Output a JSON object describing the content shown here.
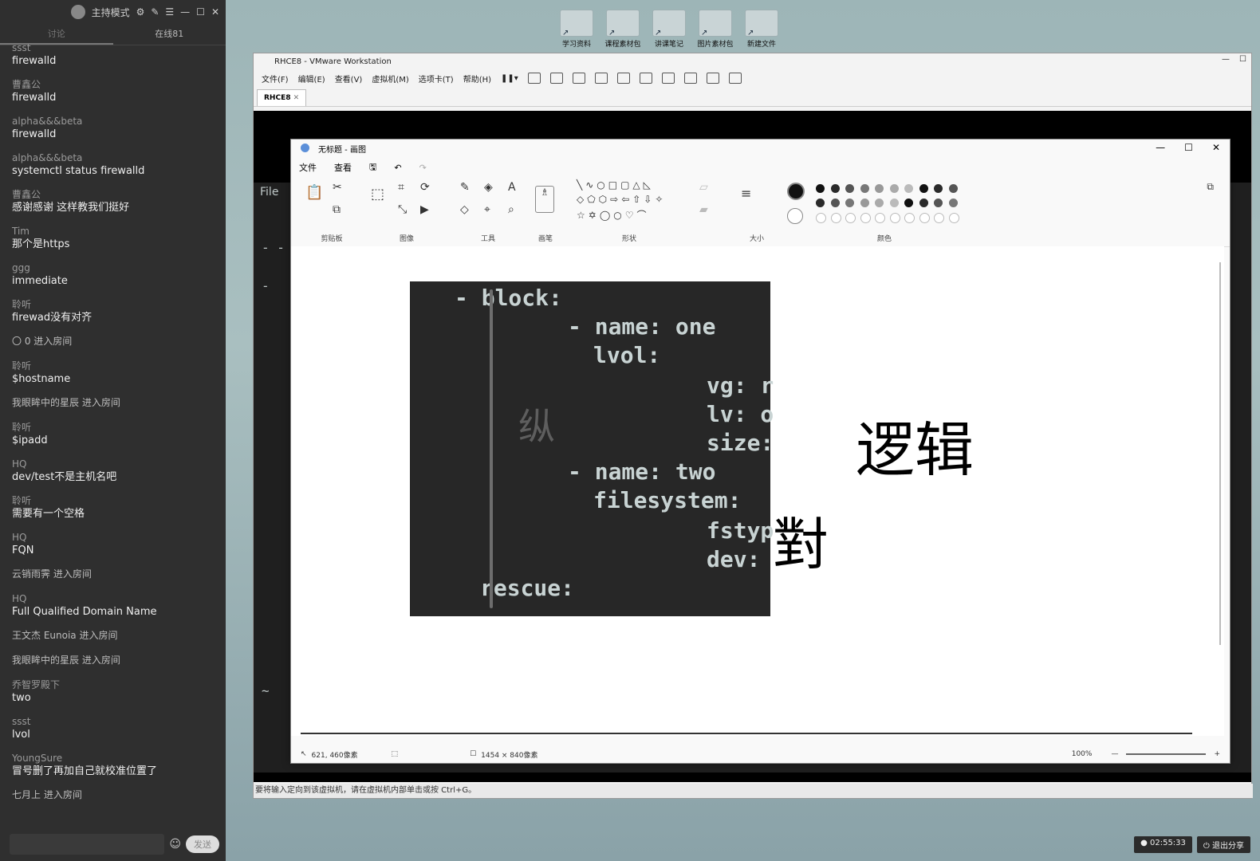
{
  "chat": {
    "title_label": "主持模式",
    "tabs": [
      "讨论",
      "在线81"
    ],
    "messages": [
      {
        "who": "ssst",
        "text": "firewalld"
      },
      {
        "who": "曹鑫公",
        "text": "firewalld"
      },
      {
        "who": "alpha&&&beta",
        "text": "firewalld"
      },
      {
        "who": "alpha&&&beta",
        "text": "systemctl status firewalld"
      },
      {
        "who": "曹鑫公",
        "text": "感谢感谢  这样教我们挺好"
      },
      {
        "who": "Tim",
        "text": "那个是https"
      },
      {
        "who": "ggg",
        "text": "immediate"
      },
      {
        "who": "聆听",
        "text": "firewad没有对齐"
      },
      {
        "system": "〇 0 进入房间"
      },
      {
        "who": "聆听",
        "text": "$hostname"
      },
      {
        "system": "我眼眸中的星辰 进入房间"
      },
      {
        "who": "聆听",
        "text": "$ipadd"
      },
      {
        "who": "HQ",
        "text": "dev/test不是主机名吧"
      },
      {
        "who": "聆听",
        "text": "需要有一个空格"
      },
      {
        "who": "HQ",
        "text": "FQN"
      },
      {
        "system": "云销雨霁 进入房间"
      },
      {
        "who": "HQ",
        "text": "Full Qualified Domain Name"
      },
      {
        "system": "王文杰 Eunoia 进入房间"
      },
      {
        "system": "我眼眸中的星辰 进入房间"
      },
      {
        "who": "乔智罗殿下",
        "text": "two"
      },
      {
        "who": "ssst",
        "text": "lvol"
      },
      {
        "who": "YoungSure",
        "text": "冒号删了再加自己就校准位置了"
      },
      {
        "system": "七月上 进入房间"
      }
    ],
    "send_label": "发送",
    "emoji_icon": "smile-icon"
  },
  "desktop": {
    "icons": [
      "学习资料",
      "课程素材包",
      "讲课笔记",
      "图片素材包",
      "新建文件"
    ]
  },
  "vmware": {
    "title": "RHCE8 - VMware Workstation",
    "menu": [
      "文件(F)",
      "编辑(E)",
      "查看(V)",
      "虚拟机(M)",
      "选项卡(T)",
      "帮助(H)"
    ],
    "tab": "RHCE8",
    "status": "要将输入定向到该虚拟机，请在虚拟机内部单击或按 Ctrl+G。",
    "guest_file_label": "File"
  },
  "paint": {
    "title": "无标题 - 画图",
    "menu": [
      "文件",
      "查看"
    ],
    "groups": [
      "剪贴板",
      "图像",
      "工具",
      "画笔",
      "形状",
      "大小",
      "颜色"
    ],
    "status_position": "621, 460像素",
    "status_size": "1454 × 840像素",
    "zoom": "100%",
    "code_lines": [
      "- block:",
      "- name: one",
      "lvol:",
      "vg: r",
      "lv: o",
      "size:",
      "- name: two",
      "filesystem:",
      "fstyp",
      "dev:",
      "rescue:"
    ],
    "handwriting": [
      "纵",
      "逻辑",
      "對"
    ],
    "colors": [
      "#111111",
      "#2a2a2a",
      "#555555",
      "#777777",
      "#999999",
      "#aaaaaa",
      "#bbbbbb"
    ]
  },
  "tray": {
    "timer": "02:55:33",
    "exit_share": "退出分享"
  }
}
